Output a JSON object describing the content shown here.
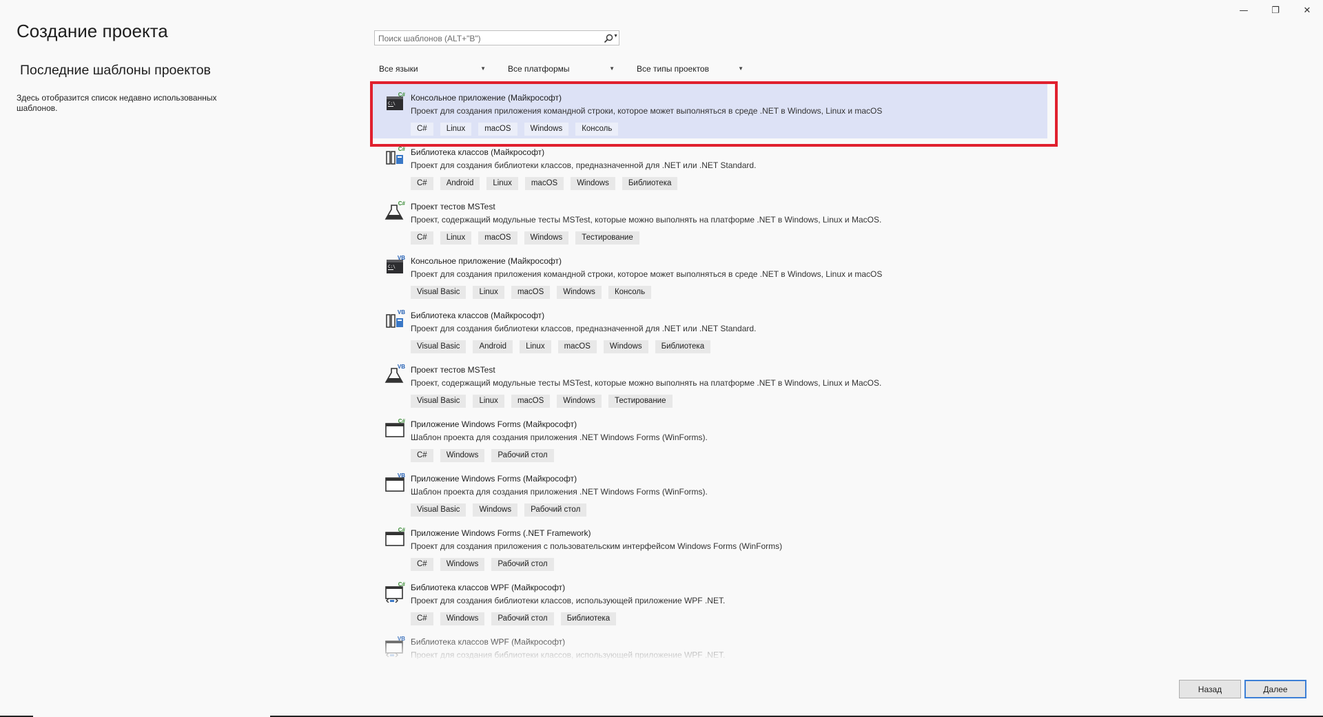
{
  "window": {
    "minimize": "—",
    "restore": "❐",
    "close": "✕"
  },
  "page_title": "Создание проекта",
  "recent": {
    "title": "Последние шаблоны проектов",
    "empty_text": "Здесь отобразится список недавно использованных шаблонов."
  },
  "search": {
    "placeholder": "Поиск шаблонов (ALT+\"В\")",
    "value": ""
  },
  "filters": {
    "language": "Все языки",
    "platform": "Все платформы",
    "project_type": "Все типы проектов"
  },
  "templates": [
    {
      "name": "Консольное приложение (Майкрософт)",
      "desc": "Проект для создания приложения командной строки, которое может выполняться в среде .NET в Windows, Linux и macOS",
      "lang_badge": "C#",
      "icon": "console-app-icon",
      "tags": [
        "C#",
        "Linux",
        "macOS",
        "Windows",
        "Консоль"
      ],
      "selected": true
    },
    {
      "name": "Библиотека классов (Майкрософт)",
      "desc": "Проект для создания библиотеки классов, предназначенной для .NET или .NET Standard.",
      "lang_badge": "C#",
      "icon": "class-library-icon",
      "tags": [
        "C#",
        "Android",
        "Linux",
        "macOS",
        "Windows",
        "Библиотека"
      ]
    },
    {
      "name": "Проект тестов MSTest",
      "desc": "Проект, содержащий модульные тесты MSTest, которые можно выполнять на платформе .NET в Windows, Linux и MacOS.",
      "lang_badge": "C#",
      "icon": "test-flask-icon",
      "tags": [
        "C#",
        "Linux",
        "macOS",
        "Windows",
        "Тестирование"
      ]
    },
    {
      "name": "Консольное приложение (Майкрософт)",
      "desc": "Проект для создания приложения командной строки, которое может выполняться в среде .NET в Windows, Linux и macOS",
      "lang_badge": "VB",
      "icon": "console-app-icon",
      "tags": [
        "Visual Basic",
        "Linux",
        "macOS",
        "Windows",
        "Консоль"
      ]
    },
    {
      "name": "Библиотека классов (Майкрософт)",
      "desc": "Проект для создания библиотеки классов, предназначенной для .NET или .NET Standard.",
      "lang_badge": "VB",
      "icon": "class-library-icon",
      "tags": [
        "Visual Basic",
        "Android",
        "Linux",
        "macOS",
        "Windows",
        "Библиотека"
      ]
    },
    {
      "name": "Проект тестов MSTest",
      "desc": "Проект, содержащий модульные тесты MSTest, которые можно выполнять на платформе .NET в Windows, Linux и MacOS.",
      "lang_badge": "VB",
      "icon": "test-flask-icon",
      "tags": [
        "Visual Basic",
        "Linux",
        "macOS",
        "Windows",
        "Тестирование"
      ]
    },
    {
      "name": "Приложение Windows Forms (Майкрософт)",
      "desc": "Шаблон проекта для создания приложения .NET Windows Forms (WinForms).",
      "lang_badge": "C#",
      "icon": "window-form-icon",
      "tags": [
        "C#",
        "Windows",
        "Рабочий стол"
      ]
    },
    {
      "name": "Приложение Windows Forms (Майкрософт)",
      "desc": "Шаблон проекта для создания приложения .NET Windows Forms (WinForms).",
      "lang_badge": "VB",
      "icon": "window-form-icon",
      "tags": [
        "Visual Basic",
        "Windows",
        "Рабочий стол"
      ]
    },
    {
      "name": "Приложение Windows Forms (.NET Framework)",
      "desc": "Проект для создания приложения с пользовательским интерфейсом Windows Forms (WinForms)",
      "lang_badge": "C#",
      "icon": "window-form-icon",
      "tags": [
        "C#",
        "Windows",
        "Рабочий стол"
      ]
    },
    {
      "name": "Библиотека классов WPF (Майкрософт)",
      "desc": "Проект для создания библиотеки классов, использующей приложение WPF .NET.",
      "lang_badge": "C#",
      "icon": "wpf-library-icon",
      "tags": [
        "C#",
        "Windows",
        "Рабочий стол",
        "Библиотека"
      ]
    },
    {
      "name": "Библиотека классов WPF (Майкрософт)",
      "desc": "Проект для создания библиотеки классов, использующей приложение WPF .NET.",
      "lang_badge": "VB",
      "icon": "wpf-library-icon",
      "tags": []
    }
  ],
  "buttons": {
    "back": "Назад",
    "next": "Далее"
  },
  "colors": {
    "selected_bg": "#dde2f6",
    "highlight_border": "#e0202e",
    "csharp_badge": "#388a34",
    "vb_badge": "#1e5cb3"
  }
}
